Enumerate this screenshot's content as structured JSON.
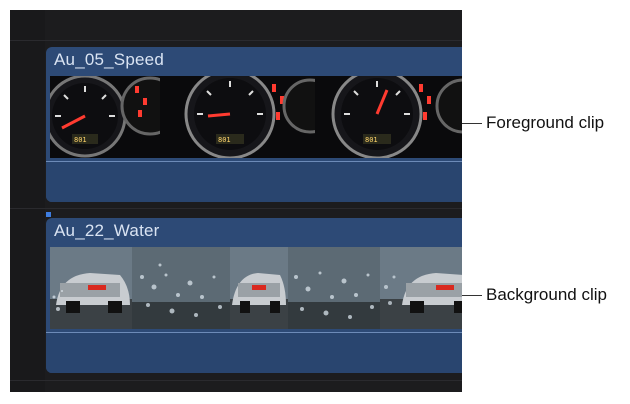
{
  "clips": [
    {
      "name": "Au_05_Speed",
      "kind": "speedometer"
    },
    {
      "name": "Au_22_Water",
      "kind": "car-water"
    }
  ],
  "callouts": {
    "foreground": "Foreground clip",
    "background": "Background clip"
  },
  "colors": {
    "clip_fill": "#2d4a76",
    "timeline_bg": "#1c1c1e",
    "title_text": "#d9e3f2"
  }
}
